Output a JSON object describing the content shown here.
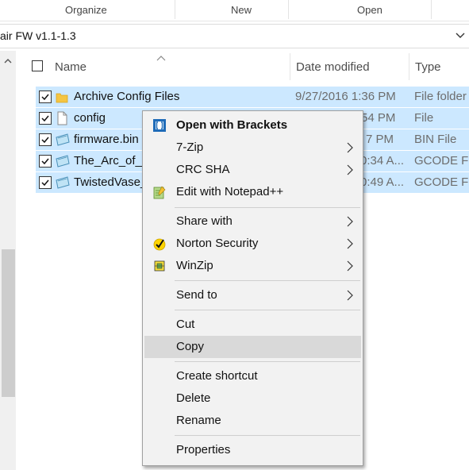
{
  "ribbon": {
    "groups": [
      "Organize",
      "New",
      "Open"
    ]
  },
  "address": {
    "path": "air FW v1.1-1.3"
  },
  "columns": {
    "name": "Name",
    "date": "Date modified",
    "type": "Type"
  },
  "files": [
    {
      "name": "Archive Config Files",
      "date": "9/27/2016 1:36 PM",
      "type": "File folder",
      "icon": "folder-icon",
      "checked": true
    },
    {
      "name": "config",
      "date": "54 PM",
      "type": "File",
      "icon": "blank-file-icon",
      "checked": true
    },
    {
      "name": "firmware.bin",
      "date": "7 PM",
      "type": "BIN File",
      "icon": "bin-file-icon",
      "checked": true
    },
    {
      "name": "The_Arc_of_tr",
      "date": "0:34 A...",
      "type": "GCODE File",
      "icon": "gcode-file-icon",
      "checked": true
    },
    {
      "name": "TwistedVase_",
      "date": "0:49 A...",
      "type": "GCODE File",
      "icon": "gcode-file-icon",
      "checked": true
    }
  ],
  "context_menu": {
    "items": [
      {
        "label": "Open with Brackets",
        "icon": "brackets-icon",
        "submenu": false,
        "bold": true
      },
      {
        "label": "7-Zip",
        "submenu": true
      },
      {
        "label": "CRC SHA",
        "submenu": true
      },
      {
        "label": "Edit with Notepad++",
        "icon": "notepad-plus-plus-icon",
        "submenu": false
      },
      {
        "label": "Share with",
        "submenu": true
      },
      {
        "label": "Norton Security",
        "icon": "norton-icon",
        "submenu": true
      },
      {
        "label": "WinZip",
        "icon": "winzip-icon",
        "submenu": true
      },
      {
        "label": "Send to",
        "submenu": true
      },
      {
        "label": "Cut",
        "submenu": false
      },
      {
        "label": "Copy",
        "submenu": false,
        "highlighted": true
      },
      {
        "label": "Create shortcut",
        "submenu": false
      },
      {
        "label": "Delete",
        "submenu": false
      },
      {
        "label": "Rename",
        "submenu": false
      },
      {
        "label": "Properties",
        "submenu": false
      }
    ]
  },
  "colors": {
    "selection": "#cce8ff",
    "menu_bg": "#f2f2f2",
    "menu_hover": "#d9d9d9"
  }
}
